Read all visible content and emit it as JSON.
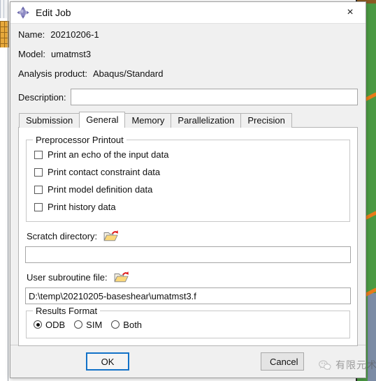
{
  "window": {
    "title": "Edit Job",
    "icon": "abaqus-diamond-icon",
    "close_label": "×"
  },
  "info": {
    "name_label": "Name:",
    "name_value": "20210206-1",
    "model_label": "Model:",
    "model_value": "umatmst3",
    "product_label": "Analysis product:",
    "product_value": "Abaqus/Standard",
    "description_label": "Description:",
    "description_value": "",
    "description_placeholder": ""
  },
  "tabs": [
    {
      "label": "Submission",
      "active": false
    },
    {
      "label": "General",
      "active": true
    },
    {
      "label": "Memory",
      "active": false
    },
    {
      "label": "Parallelization",
      "active": false
    },
    {
      "label": "Precision",
      "active": false
    }
  ],
  "preprocessor": {
    "group_title": "Preprocessor Printout",
    "checkboxes": [
      {
        "label": "Print an echo of the input data",
        "checked": false
      },
      {
        "label": "Print contact constraint data",
        "checked": false
      },
      {
        "label": "Print model definition data",
        "checked": false
      },
      {
        "label": "Print history data",
        "checked": false
      }
    ]
  },
  "scratch": {
    "label": "Scratch directory:",
    "browse_icon": "open-folder-icon",
    "value": "",
    "placeholder": ""
  },
  "subroutine": {
    "label": "User subroutine file:",
    "browse_icon": "open-folder-icon",
    "value": "D:\\temp\\20210205-baseshear\\umatmst3.f",
    "placeholder": ""
  },
  "results_format": {
    "group_title": "Results Format",
    "options": [
      {
        "label": "ODB",
        "selected": true
      },
      {
        "label": "SIM",
        "selected": false
      },
      {
        "label": "Both",
        "selected": false
      }
    ]
  },
  "footer": {
    "ok_label": "OK",
    "cancel_label": "Cancel"
  },
  "watermark": {
    "text": "有限元术",
    "logo": "wechat-icon"
  },
  "colors": {
    "accent_focus": "#1272c8",
    "viewport_green": "#4b9a43",
    "mesh_orange": "#e87b18",
    "dialog_bg": "#f0f0f0"
  }
}
